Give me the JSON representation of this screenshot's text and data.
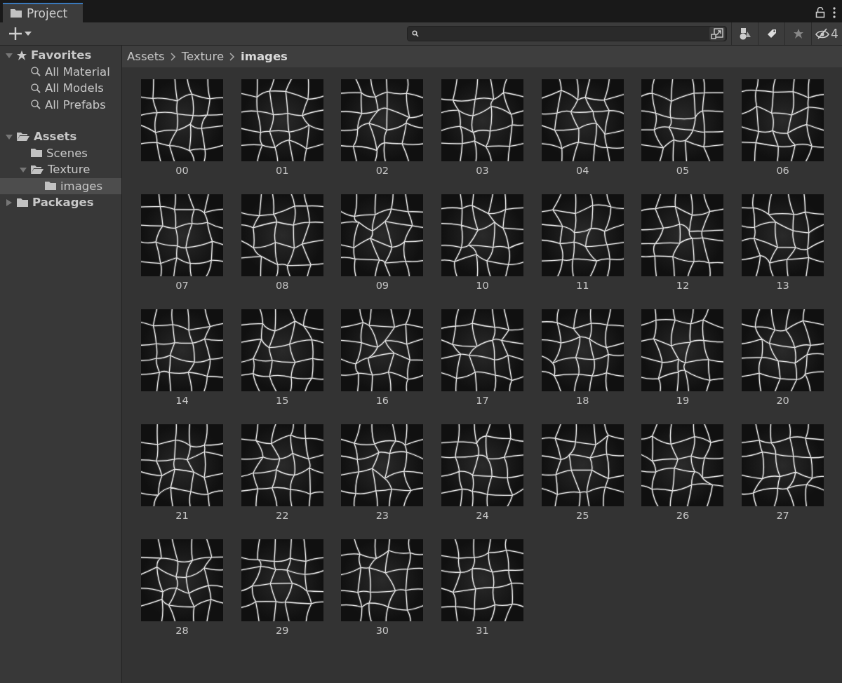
{
  "tab": {
    "label": "Project",
    "selected": true
  },
  "toolbar": {
    "hidden_count": "4"
  },
  "sidebar": {
    "items": [
      {
        "kind": "favorites",
        "label": "Favorites",
        "expanded": true,
        "selected": false,
        "children": [
          {
            "kind": "search",
            "label": "All Material",
            "selected": false
          },
          {
            "kind": "search",
            "label": "All Models",
            "selected": false
          },
          {
            "kind": "search",
            "label": "All Prefabs",
            "selected": false
          }
        ]
      },
      {
        "kind": "folder",
        "label": "Assets",
        "expanded": true,
        "selected": false,
        "children": [
          {
            "kind": "folder",
            "label": "Scenes",
            "selected": false
          },
          {
            "kind": "folder",
            "label": "Texture",
            "expanded": true,
            "selected": false,
            "children": [
              {
                "kind": "folder",
                "label": "images",
                "selected": true
              }
            ]
          }
        ]
      },
      {
        "kind": "folder",
        "label": "Packages",
        "expanded": false,
        "selected": false
      }
    ]
  },
  "breadcrumb": [
    "Assets",
    "Texture",
    "images"
  ],
  "assets": [
    "00",
    "01",
    "02",
    "03",
    "04",
    "05",
    "06",
    "07",
    "08",
    "09",
    "10",
    "11",
    "12",
    "13",
    "14",
    "15",
    "16",
    "17",
    "18",
    "19",
    "20",
    "21",
    "22",
    "23",
    "24",
    "25",
    "26",
    "27",
    "28",
    "29",
    "30",
    "31"
  ]
}
